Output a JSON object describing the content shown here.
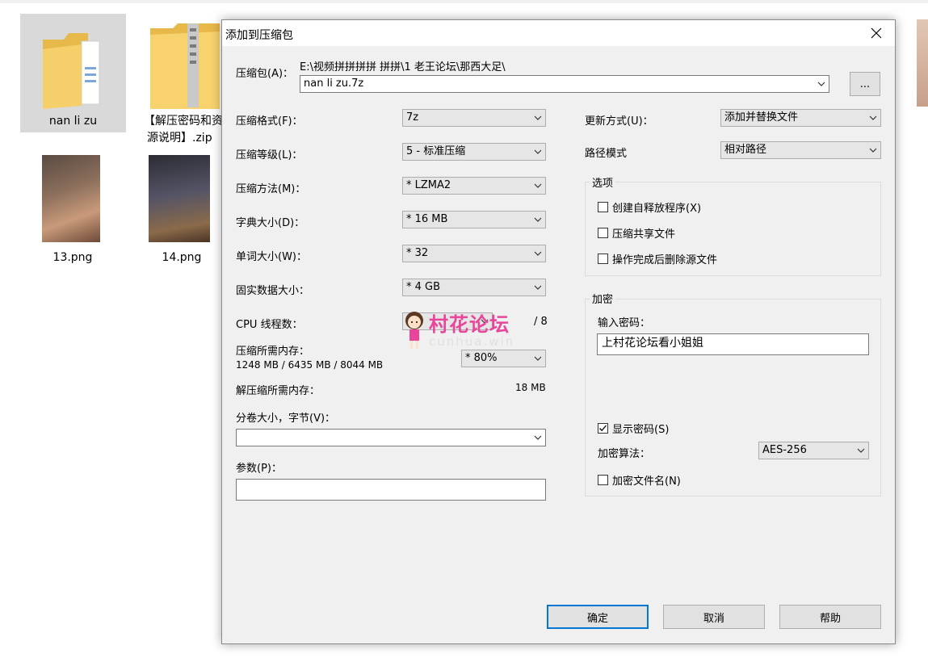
{
  "explorer": {
    "files": [
      {
        "name": "nan li zu",
        "type": "folder"
      },
      {
        "name_line1": "【解压密码和资",
        "name_line2": "源说明】.zip",
        "type": "zip"
      },
      {
        "name": "13.png",
        "type": "image"
      },
      {
        "name": "14.png",
        "type": "image"
      }
    ]
  },
  "dialog": {
    "title": "添加到压缩包",
    "archive": {
      "label": "压缩包(A)：",
      "path": "E:\\视频拼拼拼拼 拼拼\\1 老王论坛\\那西大足\\",
      "filename": "nan li zu.7z",
      "browse_label": "..."
    },
    "left": {
      "format": {
        "label": "压缩格式(F)：",
        "value": "7z"
      },
      "level": {
        "label": "压缩等级(L)：",
        "value": "5 - 标准压缩"
      },
      "method": {
        "label": "压缩方法(M)：",
        "value": "* LZMA2"
      },
      "dict": {
        "label": "字典大小(D)：",
        "value": "* 16 MB"
      },
      "word": {
        "label": "单词大小(W)：",
        "value": "* 32"
      },
      "solid": {
        "label": "固实数据大小：",
        "value": "* 4 GB"
      },
      "cpu": {
        "label": "CPU 线程数：",
        "total": "/ 8"
      },
      "mem_compress": {
        "label": "压缩所需内存：",
        "value": "1248 MB / 6435 MB / 8044 MB",
        "percent": "* 80%"
      },
      "mem_decompress": {
        "label": "解压缩所需内存：",
        "value": "18 MB"
      },
      "split": {
        "label": "分卷大小，字节(V)：",
        "value": ""
      },
      "params": {
        "label": "参数(P)：",
        "value": ""
      }
    },
    "right": {
      "update": {
        "label": "更新方式(U)：",
        "value": "添加并替换文件"
      },
      "pathmode": {
        "label": "路径模式",
        "value": "相对路径"
      },
      "options": {
        "title": "选项",
        "sfx": "创建自释放程序(X)",
        "shared": "压缩共享文件",
        "delete": "操作完成后删除源文件"
      },
      "encryption": {
        "title": "加密",
        "password_label": "输入密码：",
        "password": "上村花论坛看小姐姐",
        "show_password": "显示密码(S)",
        "method_label": "加密算法：",
        "method": "AES-256",
        "encrypt_names": "加密文件名(N)"
      }
    },
    "buttons": {
      "ok": "确定",
      "cancel": "取消",
      "help": "帮助"
    }
  },
  "watermark": {
    "text": "村花论坛",
    "sub": "cunhua.win"
  }
}
